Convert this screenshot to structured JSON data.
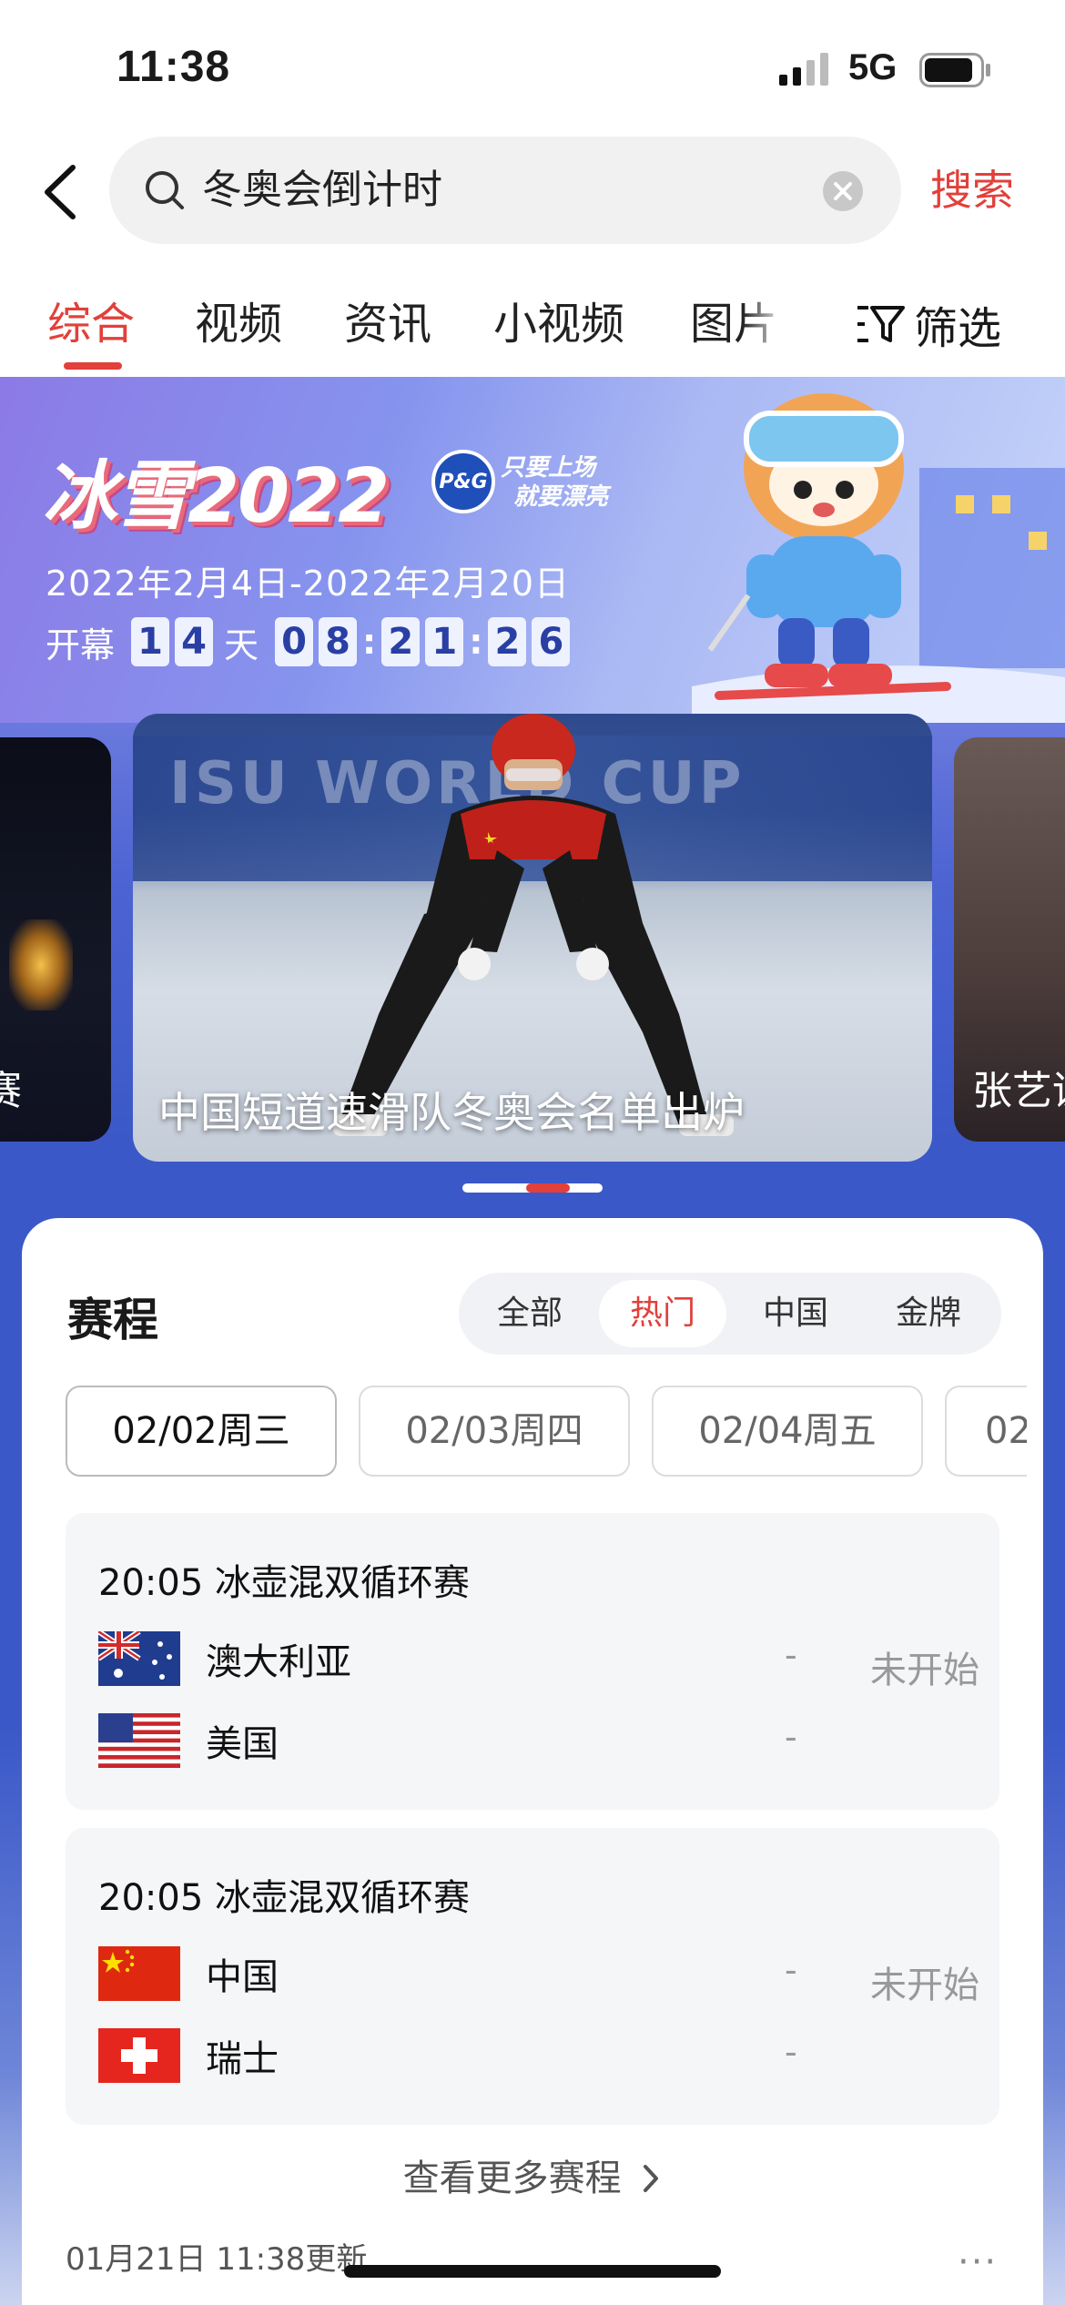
{
  "status_bar": {
    "time": "11:38",
    "network": "5G"
  },
  "search": {
    "query": "冬奥会倒计时",
    "button": "搜索"
  },
  "tabs": [
    {
      "label": "综合",
      "active": true
    },
    {
      "label": "视频"
    },
    {
      "label": "资讯"
    },
    {
      "label": "小视频"
    },
    {
      "label": "图片"
    }
  ],
  "filter_label": "筛选",
  "banner": {
    "logo": "冰雪2022",
    "sponsor_badge": "P&G",
    "sponsor_slogan_line1": "只要上场",
    "sponsor_slogan_line2": "就要漂亮",
    "date_range": "2022年2月4日-2022年2月20日",
    "countdown": {
      "label": "开幕",
      "days": [
        "1",
        "4"
      ],
      "days_unit": "天",
      "hours": [
        "0",
        "8"
      ],
      "minutes": [
        "2",
        "1"
      ],
      "seconds": [
        "2",
        "6"
      ]
    }
  },
  "carousel": {
    "left_label": "赛",
    "main_caption": "中国短道速滑队冬奥会名单出炉",
    "right_label": "张艺谋",
    "rink_text": "ISU WORLD CUP"
  },
  "schedule": {
    "title": "赛程",
    "filters": [
      {
        "label": "全部"
      },
      {
        "label": "热门",
        "active": true
      },
      {
        "label": "中国"
      },
      {
        "label": "金牌"
      }
    ],
    "dates": [
      {
        "label": "02/02周三",
        "active": true
      },
      {
        "label": "02/03周四"
      },
      {
        "label": "02/04周五"
      },
      {
        "label": "02"
      }
    ],
    "matches": [
      {
        "title": "20:05  冰壶混双循环赛",
        "team1": "澳大利亚",
        "score1": "-",
        "team2": "美国",
        "score2": "-",
        "state": "未开始"
      },
      {
        "title": "20:05  冰壶混双循环赛",
        "team1": "中国",
        "score1": "-",
        "team2": "瑞士",
        "score2": "-",
        "state": "未开始"
      }
    ],
    "more_link": "查看更多赛程",
    "updated": "01月21日 11:38更新",
    "more_menu": "···"
  },
  "colors": {
    "accent": "#e2403a",
    "banner_blue": "#3b58c8"
  }
}
